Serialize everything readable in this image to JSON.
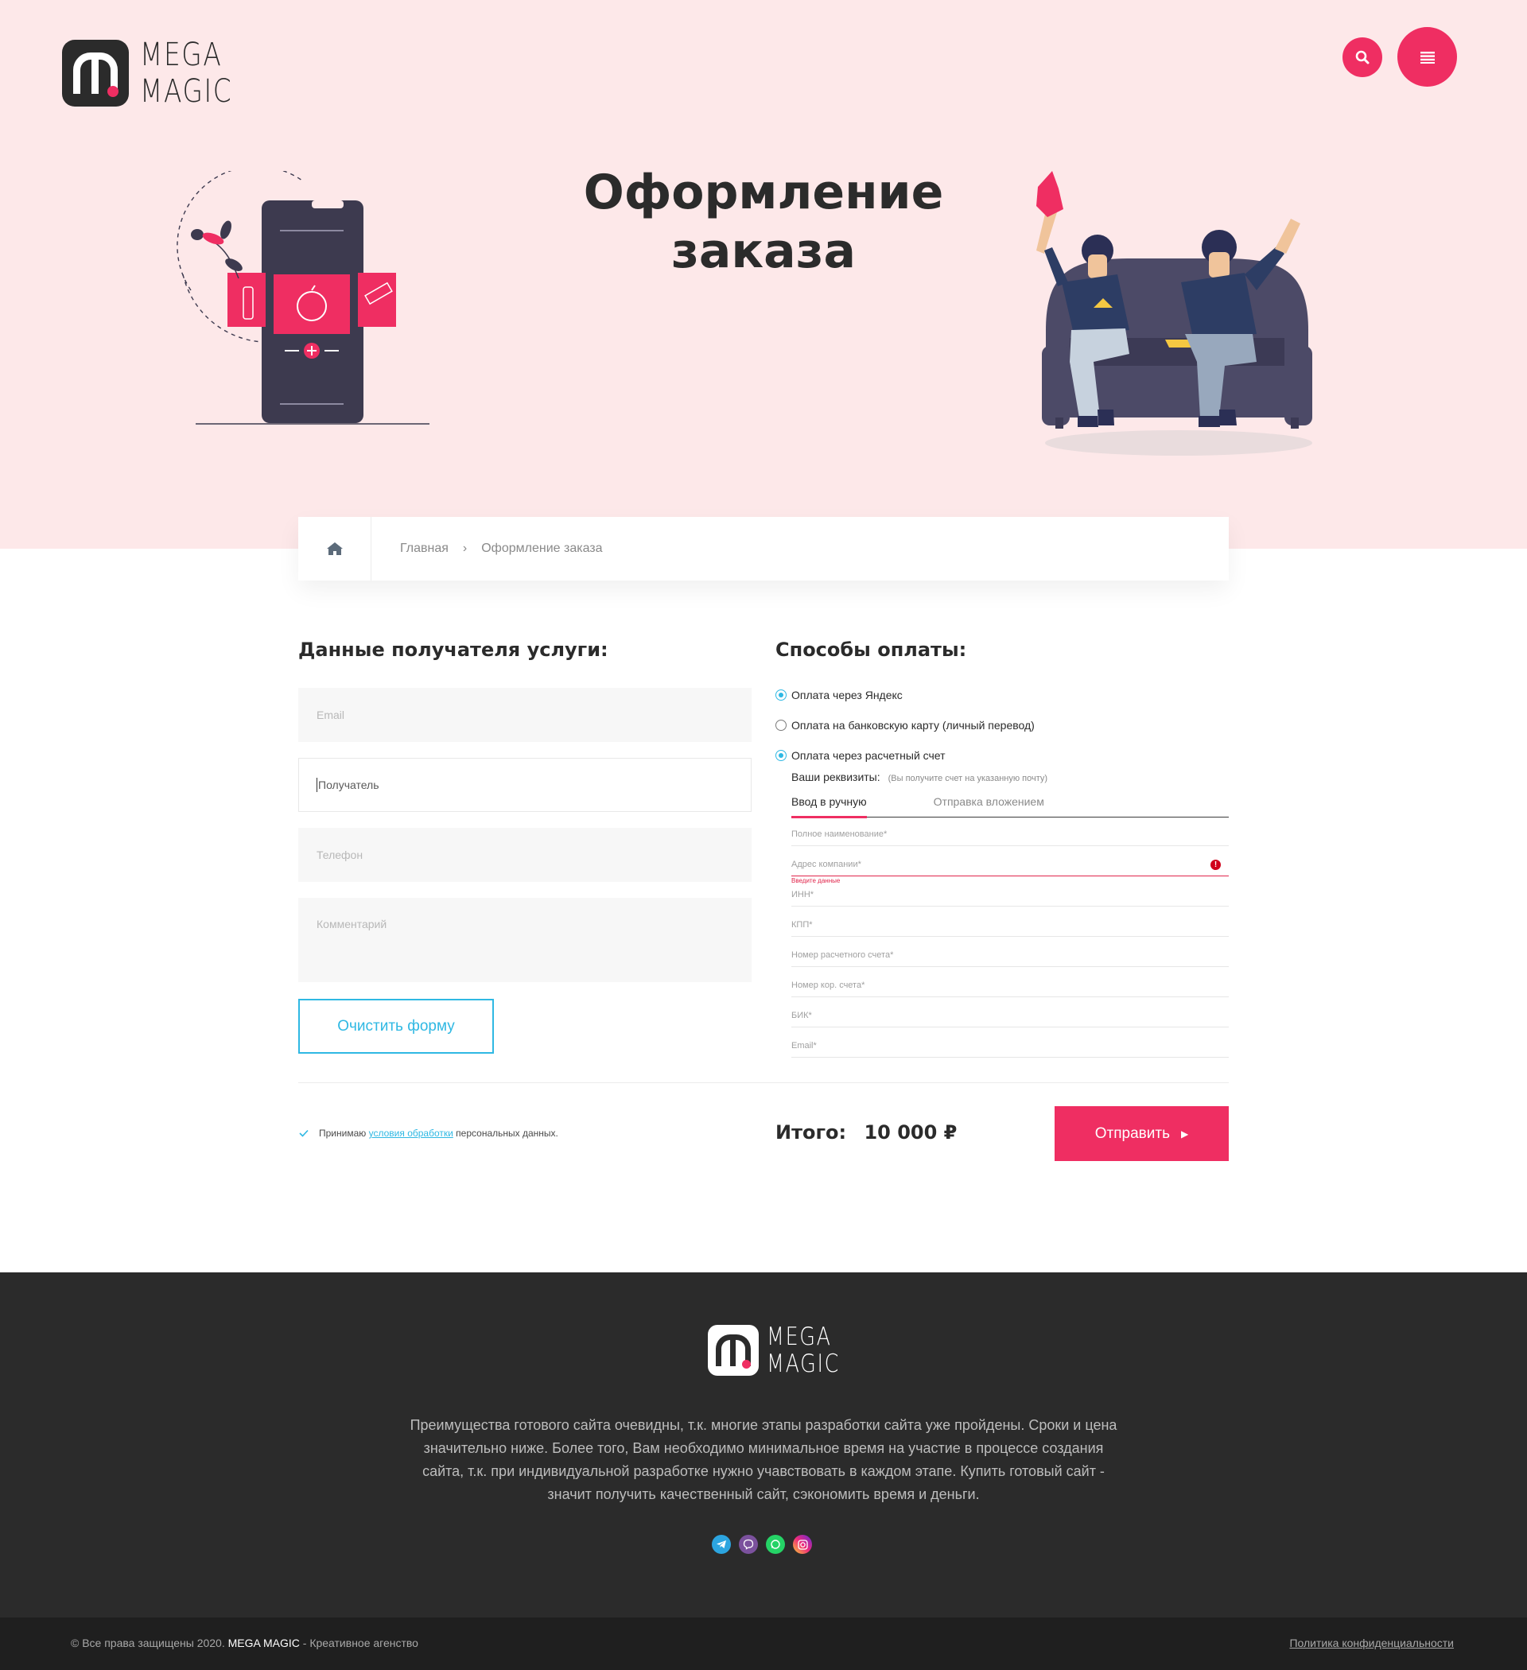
{
  "brand": {
    "line1": "MEGA",
    "line2": "MAGIC"
  },
  "header": {
    "title": "Оформление заказа"
  },
  "breadcrumb": {
    "items": [
      "Главная",
      "Оформление заказа"
    ],
    "separator": "›"
  },
  "recipient": {
    "heading": "Данные получателя услуги:",
    "email_placeholder": "Email",
    "name_placeholder": "Получатель",
    "phone_placeholder": "Телефон",
    "comment_placeholder": "Комментарий",
    "clear_button": "Очистить форму"
  },
  "payment": {
    "heading": "Способы оплаты:",
    "options": [
      {
        "label": "Оплата через Яндекс",
        "checked": true
      },
      {
        "label": "Оплата на банковскую карту (личный перевод)",
        "checked": false
      },
      {
        "label": "Оплата через расчетный счет",
        "checked": true
      }
    ],
    "requisites_label": "Ваши реквизиты:",
    "requisites_hint": "(Вы получите счет на указанную почту)",
    "tabs": [
      "Ввод в ручную",
      "Отправка вложением"
    ],
    "fields": [
      "Полное наименование*",
      "Адрес компании*",
      "ИНН*",
      "КПП*",
      "Номер расчетного счета*",
      "Номер кор. счета*",
      "БИК*",
      "Email*"
    ],
    "error_text": "Введите данные"
  },
  "agreement": {
    "prefix": "Принимаю",
    "link": "условия обработки",
    "suffix": "персональных данных."
  },
  "total": {
    "label": "Итого:",
    "value": "10 000 ₽"
  },
  "submit_button": "Отправить",
  "footer": {
    "description": "Преимущества готового сайта очевидны, т.к. многие этапы разработки сайта уже пройдены. Сроки и цена значительно ниже. Более того, Вам необходимо минимальное время на участие в процессе создания сайта, т.к. при индивидуальной разработке нужно учавствовать в каждом этапе. Купить готовый сайт - значит получить качественный сайт, сэкономить время и деньги.",
    "socials": [
      "telegram-icon",
      "viber-icon",
      "whatsapp-icon",
      "instagram-icon"
    ],
    "copyright_prefix": "© Все права защищены 2020.",
    "copyright_brand": "MEGA MAGIC",
    "copyright_suffix": "- Креативное агенство",
    "policy": "Политика конфиденциальности"
  },
  "colors": {
    "accent": "#ef2e62",
    "link": "#2fb8e3",
    "hero_bg": "#fde8e9",
    "footer_bg": "#2b2b2b",
    "bottom_bg": "#1f1f1f"
  }
}
